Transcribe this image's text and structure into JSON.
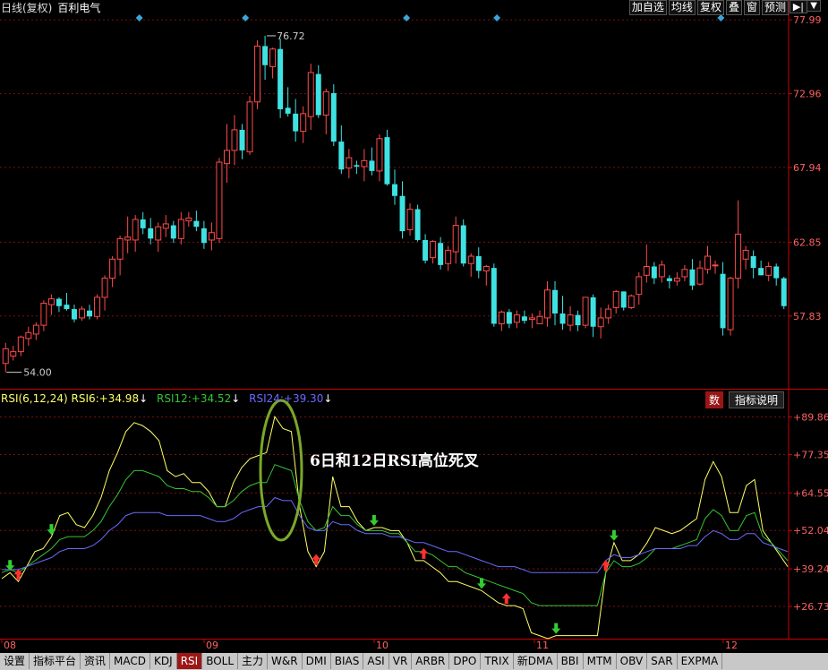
{
  "window": {
    "title": "日线(复权)",
    "stock_name": "百利电气"
  },
  "toolbar": [
    "加自选",
    "均线",
    "复权",
    "叠",
    "窗",
    "预测"
  ],
  "toolbar_icon": "▶|",
  "toolbar_menu": "▼",
  "rsi_header": {
    "name": "RSI(6,12,24)",
    "rsi6_label": "RSI6:",
    "rsi6_value": "+34.98",
    "rsi12_label": "RSI12:",
    "rsi12_value": "+34.52",
    "rsi24_label": "RSI24:",
    "rsi24_value": "+39.30",
    "arrow": "↓"
  },
  "rsi_buttons": {
    "shu": "数",
    "help": "指标说明"
  },
  "annotation": "6日和12日RSI高位死叉",
  "tabs": [
    "设置",
    "指标平台",
    "资讯",
    "MACD",
    "KDJ",
    "RSI",
    "BOLL",
    "主力",
    "W&R",
    "DMI",
    "BIAS",
    "ASI",
    "VR",
    "ARBR",
    "DPO",
    "TRIX",
    "新DMA",
    "BBI",
    "MTM",
    "OBV",
    "SAR",
    "EXPMA"
  ],
  "active_tab": "RSI",
  "colors": {
    "up": "#ff4a4a",
    "down": "#3fe2e2",
    "rsi6": "#ffff66",
    "rsi12": "#33c533",
    "rsi24": "#6a6aff",
    "axis": "#cc0000",
    "grid": "#7a1010",
    "annot_ellipse": "#7aa82a"
  },
  "chart_data": [
    {
      "type": "candlestick",
      "y_ticks": [
        "77.99",
        "72.96",
        "67.94",
        "62.85",
        "57.83"
      ],
      "ylim": [
        53.0,
        78.3
      ],
      "max_label": "76.72",
      "min_label": "54.00",
      "series": [
        {
          "name": "K",
          "ohlc": [
            [
              54.6,
              56.0,
              54.0,
              55.6
            ],
            [
              55.1,
              55.8,
              54.8,
              55.4
            ],
            [
              55.4,
              56.5,
              55.1,
              56.4
            ],
            [
              56.3,
              57.1,
              55.8,
              56.7
            ],
            [
              56.6,
              57.4,
              56.2,
              57.2
            ],
            [
              57.2,
              58.9,
              56.8,
              58.7
            ],
            [
              58.6,
              59.3,
              57.9,
              59.0
            ],
            [
              59.0,
              59.1,
              58.1,
              58.5
            ],
            [
              58.6,
              59.4,
              58.2,
              58.3
            ],
            [
              58.3,
              58.6,
              57.4,
              57.6
            ],
            [
              57.7,
              58.5,
              57.5,
              58.3
            ],
            [
              58.2,
              58.6,
              57.6,
              57.8
            ],
            [
              57.8,
              59.3,
              57.6,
              59.1
            ],
            [
              59.1,
              60.6,
              58.2,
              60.4
            ],
            [
              60.4,
              61.9,
              59.8,
              61.7
            ],
            [
              61.7,
              63.3,
              60.6,
              63.1
            ],
            [
              63.0,
              64.6,
              62.1,
              63.2
            ],
            [
              63.0,
              64.7,
              62.2,
              64.4
            ],
            [
              64.4,
              64.9,
              63.4,
              63.8
            ],
            [
              63.8,
              64.5,
              62.7,
              63.1
            ],
            [
              63.0,
              64.2,
              62.2,
              63.9
            ],
            [
              63.8,
              64.7,
              63.2,
              64.1
            ],
            [
              64.0,
              64.3,
              62.8,
              63.1
            ],
            [
              63.1,
              64.9,
              62.7,
              64.4
            ],
            [
              64.3,
              64.9,
              63.9,
              64.5
            ],
            [
              64.3,
              65.0,
              63.6,
              63.9
            ],
            [
              63.8,
              64.3,
              62.4,
              62.8
            ],
            [
              63.0,
              64.2,
              62.3,
              63.5
            ],
            [
              63.1,
              68.6,
              62.8,
              68.3
            ],
            [
              68.2,
              70.9,
              66.9,
              69.1
            ],
            [
              69.1,
              71.5,
              68.1,
              70.5
            ],
            [
              70.5,
              70.9,
              68.5,
              69.1
            ],
            [
              69.0,
              72.8,
              68.8,
              72.4
            ],
            [
              72.4,
              76.6,
              71.9,
              76.2
            ],
            [
              76.2,
              76.9,
              73.9,
              74.9
            ],
            [
              74.8,
              76.1,
              74.0,
              76.0
            ],
            [
              76.0,
              76.7,
              71.3,
              71.9
            ],
            [
              72.0,
              73.4,
              71.4,
              71.6
            ],
            [
              71.6,
              72.6,
              69.7,
              70.4
            ],
            [
              70.4,
              72.1,
              69.6,
              71.6
            ],
            [
              71.4,
              75.0,
              70.5,
              74.4
            ],
            [
              74.3,
              74.9,
              71.3,
              71.5
            ],
            [
              71.5,
              73.3,
              70.2,
              73.1
            ],
            [
              73.0,
              73.6,
              69.4,
              69.7
            ],
            [
              69.7,
              70.8,
              67.5,
              67.8
            ],
            [
              67.9,
              69.2,
              67.2,
              68.6
            ],
            [
              68.1,
              68.4,
              67.5,
              68.0
            ],
            [
              68.0,
              69.2,
              67.0,
              68.4
            ],
            [
              68.4,
              69.3,
              67.4,
              67.7
            ],
            [
              67.7,
              70.2,
              67.0,
              69.9
            ],
            [
              70.0,
              70.5,
              66.7,
              66.8
            ],
            [
              66.8,
              67.8,
              65.4,
              66.0
            ],
            [
              66.0,
              67.0,
              63.1,
              63.6
            ],
            [
              63.7,
              65.5,
              63.3,
              65.1
            ],
            [
              65.1,
              65.4,
              62.9,
              63.0
            ],
            [
              63.0,
              63.4,
              61.4,
              61.6
            ],
            [
              61.8,
              63.0,
              61.4,
              62.9
            ],
            [
              62.8,
              63.2,
              61.0,
              61.3
            ],
            [
              61.4,
              62.6,
              60.9,
              62.3
            ],
            [
              62.2,
              64.6,
              61.4,
              64.0
            ],
            [
              64.0,
              64.4,
              61.2,
              61.4
            ],
            [
              61.4,
              62.1,
              60.5,
              61.9
            ],
            [
              61.9,
              62.5,
              60.4,
              60.9
            ],
            [
              60.9,
              61.3,
              59.9,
              61.2
            ],
            [
              61.1,
              61.4,
              57.1,
              57.3
            ],
            [
              57.3,
              58.2,
              56.8,
              58.1
            ],
            [
              58.1,
              58.3,
              57.0,
              57.3
            ],
            [
              57.4,
              58.2,
              57.0,
              57.9
            ],
            [
              57.8,
              58.2,
              57.3,
              57.5
            ],
            [
              57.6,
              58.0,
              57.0,
              57.7
            ],
            [
              57.3,
              58.2,
              57.3,
              57.8
            ],
            [
              57.7,
              60.2,
              57.1,
              59.6
            ],
            [
              59.6,
              60.2,
              57.2,
              58.0
            ],
            [
              58.0,
              59.2,
              56.9,
              57.3
            ],
            [
              57.2,
              58.5,
              56.8,
              57.9
            ],
            [
              57.9,
              58.2,
              56.8,
              57.2
            ],
            [
              57.2,
              59.1,
              57.0,
              59.1
            ],
            [
              59.1,
              59.3,
              56.4,
              57.1
            ],
            [
              57.1,
              58.4,
              56.3,
              57.7
            ],
            [
              57.7,
              58.6,
              57.3,
              58.3
            ],
            [
              58.4,
              59.6,
              58.0,
              59.5
            ],
            [
              59.5,
              59.5,
              58.2,
              58.4
            ],
            [
              58.4,
              59.3,
              58.3,
              59.2
            ],
            [
              59.3,
              60.8,
              58.6,
              60.5
            ],
            [
              60.6,
              62.7,
              60.1,
              61.2
            ],
            [
              61.2,
              61.5,
              60.0,
              60.4
            ],
            [
              60.5,
              61.6,
              60.1,
              61.3
            ],
            [
              60.4,
              60.6,
              59.7,
              60.2
            ],
            [
              60.2,
              60.8,
              59.9,
              60.4
            ],
            [
              60.5,
              61.3,
              60.2,
              61.0
            ],
            [
              61.0,
              61.7,
              59.6,
              59.9
            ],
            [
              60.0,
              61.6,
              59.9,
              61.1
            ],
            [
              61.0,
              62.6,
              60.7,
              61.9
            ],
            [
              61.3,
              61.6,
              60.7,
              61.3
            ],
            [
              60.7,
              61.5,
              56.5,
              57.0
            ],
            [
              56.9,
              60.5,
              56.5,
              60.4
            ],
            [
              60.4,
              65.7,
              59.7,
              63.4
            ],
            [
              61.7,
              62.6,
              61.0,
              62.3
            ],
            [
              61.9,
              62.3,
              60.4,
              61.1
            ],
            [
              61.1,
              61.6,
              60.7,
              60.6
            ],
            [
              60.6,
              61.5,
              60.2,
              61.2
            ],
            [
              61.2,
              61.4,
              59.9,
              60.4
            ],
            [
              60.4,
              60.5,
              58.3,
              58.5
            ]
          ]
        }
      ]
    },
    {
      "type": "line",
      "y_ticks": [
        "+89.86",
        "+77.35",
        "+64.55",
        "+52.04",
        "+39.24",
        "+26.73"
      ],
      "ylim": [
        16.0,
        93.0
      ],
      "series": [
        {
          "name": "RSI6",
          "values": [
            36,
            38,
            35,
            40,
            45,
            46,
            50,
            57,
            58,
            54,
            53,
            57,
            63,
            72,
            78,
            85,
            88,
            87,
            85,
            82,
            72,
            70,
            71,
            68,
            68,
            65,
            60,
            60,
            68,
            73,
            76,
            77,
            78,
            90,
            86,
            85,
            60,
            45,
            40,
            45,
            70,
            60,
            60,
            55,
            52,
            53,
            53,
            52,
            52,
            48,
            42,
            42,
            40,
            38,
            35,
            35,
            34,
            33,
            32,
            30,
            28,
            27,
            27,
            26,
            18,
            17,
            16,
            17,
            17,
            17,
            17,
            17,
            17,
            38,
            48,
            42,
            42,
            44,
            48,
            53,
            52,
            51,
            52,
            54,
            56,
            69,
            75,
            70,
            58,
            58,
            67,
            69,
            52,
            48,
            44,
            40
          ]
        },
        {
          "name": "RSI12",
          "values": [
            38,
            39,
            38,
            40,
            42,
            44,
            46,
            49,
            50,
            50,
            50,
            52,
            55,
            60,
            64,
            69,
            72,
            72,
            71,
            70,
            67,
            66,
            66,
            65,
            65,
            63,
            60,
            60,
            62,
            65,
            67,
            68,
            68,
            74,
            73,
            72,
            62,
            55,
            52,
            53,
            60,
            57,
            57,
            54,
            52,
            52,
            52,
            51,
            51,
            48,
            45,
            45,
            44,
            42,
            40,
            40,
            38,
            37,
            36,
            35,
            34,
            33,
            32,
            31,
            28,
            27,
            27,
            27,
            27,
            27,
            27,
            27,
            27,
            38,
            42,
            40,
            40,
            41,
            43,
            46,
            46,
            46,
            47,
            48,
            49,
            56,
            59,
            57,
            52,
            52,
            57,
            58,
            50,
            48,
            45,
            42
          ]
        },
        {
          "name": "RSI24",
          "values": [
            39,
            39,
            39,
            40,
            41,
            42,
            43,
            45,
            46,
            46,
            46,
            47,
            49,
            52,
            54,
            57,
            58,
            58,
            58,
            58,
            57,
            57,
            57,
            57,
            57,
            56,
            55,
            55,
            56,
            58,
            59,
            60,
            60,
            63,
            62,
            62,
            57,
            53,
            52,
            52,
            55,
            54,
            54,
            52,
            51,
            51,
            51,
            50,
            50,
            49,
            48,
            48,
            47,
            46,
            45,
            45,
            44,
            43,
            42,
            41,
            40,
            40,
            40,
            39,
            38,
            38,
            38,
            38,
            38,
            38,
            38,
            38,
            38,
            42,
            44,
            43,
            43,
            44,
            45,
            46,
            46,
            46,
            46,
            47,
            47,
            50,
            52,
            51,
            49,
            49,
            51,
            51,
            48,
            47,
            46,
            45
          ]
        }
      ]
    },
    {
      "type": "category_axis",
      "x_labels": [
        "08",
        "09",
        "10",
        "11",
        "12"
      ]
    }
  ]
}
